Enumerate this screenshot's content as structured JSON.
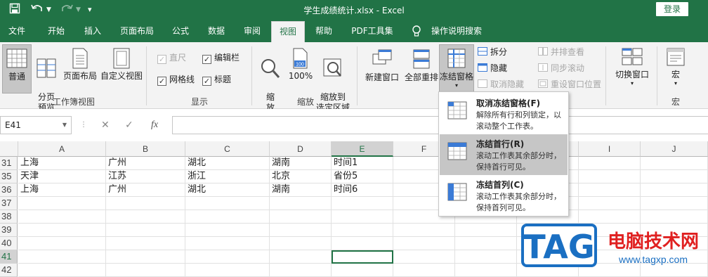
{
  "title": {
    "text": "学生成绩统计.xlsx  -  Excel",
    "login": "登录"
  },
  "quick_access": {
    "save_icon": "save-icon",
    "undo_icon": "undo-icon",
    "redo_icon": "redo-icon",
    "customize_icon": "customize-icon"
  },
  "tabs": [
    "文件",
    "开始",
    "插入",
    "页面布局",
    "公式",
    "数据",
    "审阅",
    "视图",
    "帮助",
    "PDF工具集",
    "操作说明搜索"
  ],
  "active_tab": "视图",
  "ribbon": {
    "workbook_views": {
      "normal": "普通",
      "page_break": "分页\n预览",
      "page_layout": "页面布局",
      "custom": "自定义视图",
      "label": "工作簿视图"
    },
    "show": {
      "ruler": "直尺",
      "formula_bar": "编辑栏",
      "gridlines": "网格线",
      "headings": "标题",
      "label": "显示"
    },
    "zoom": {
      "zoom": "缩\n放",
      "zoom100": "100%",
      "zoom_sel": "缩放到\n选定区域",
      "label": "缩放",
      "badge": "100"
    },
    "window": {
      "new_window": "新建窗口",
      "arrange_all": "全部重排",
      "freeze": "冻结窗格",
      "split": "拆分",
      "hide": "隐藏",
      "unhide": "取消隐藏",
      "side_by_side": "并排查看",
      "sync_scroll": "同步滚动",
      "reset_pos": "重设窗口位置",
      "switch": "切换窗口"
    },
    "macros": {
      "macros": "宏",
      "label": "宏"
    }
  },
  "formula_bar": {
    "name_box": "E41",
    "cancel": "✕",
    "enter": "✓",
    "fx": "fx",
    "value": ""
  },
  "columns": [
    "A",
    "B",
    "C",
    "D",
    "E",
    "F",
    "G",
    "H",
    "I",
    "J"
  ],
  "selected_column": "E",
  "rows": [
    {
      "num": "31",
      "cells": [
        "上海",
        "广州",
        "湖北",
        "湖南",
        "时间1",
        "",
        "",
        "",
        "",
        ""
      ]
    },
    {
      "num": "35",
      "cells": [
        "天津",
        "江苏",
        "浙江",
        "北京",
        "省份5",
        "",
        "",
        "",
        "",
        ""
      ]
    },
    {
      "num": "36",
      "cells": [
        "上海",
        "广州",
        "湖北",
        "湖南",
        "时间6",
        "",
        "",
        "",
        "",
        ""
      ]
    },
    {
      "num": "37",
      "cells": [
        "",
        "",
        "",
        "",
        "",
        "",
        "",
        "",
        "",
        ""
      ]
    },
    {
      "num": "38",
      "cells": [
        "",
        "",
        "",
        "",
        "",
        "",
        "",
        "",
        "",
        ""
      ]
    },
    {
      "num": "39",
      "cells": [
        "",
        "",
        "",
        "",
        "",
        "",
        "",
        "",
        "",
        ""
      ]
    },
    {
      "num": "40",
      "cells": [
        "",
        "",
        "",
        "",
        "",
        "",
        "",
        "",
        "",
        ""
      ]
    },
    {
      "num": "41",
      "cells": [
        "",
        "",
        "",
        "",
        "",
        "",
        "",
        "",
        "",
        ""
      ]
    },
    {
      "num": "42",
      "cells": [
        "",
        "",
        "",
        "",
        "",
        "",
        "",
        "",
        "",
        ""
      ]
    }
  ],
  "selected_cell": "E41",
  "freeze_menu": [
    {
      "title": "取消冻结窗格(F)",
      "desc": "解除所有行和列锁定，以滚动整个工作表。",
      "icon": "unfreeze-panes-icon"
    },
    {
      "title": "冻结首行(R)",
      "desc": "滚动工作表其余部分时，保持首行可见。",
      "icon": "freeze-top-row-icon"
    },
    {
      "title": "冻结首列(C)",
      "desc": "滚动工作表其余部分时，保持首列可见。",
      "icon": "freeze-first-column-icon"
    }
  ],
  "watermark": {
    "logo": "TAG",
    "cn": "电脑技术网",
    "url": "www.tagxp.com"
  },
  "colors": {
    "excel_green": "#217346",
    "ribbon_bg": "#f3f3f3",
    "selected": "#c6c6c6",
    "watermark_red": "#e02020",
    "watermark_blue": "#1a6fc2"
  }
}
